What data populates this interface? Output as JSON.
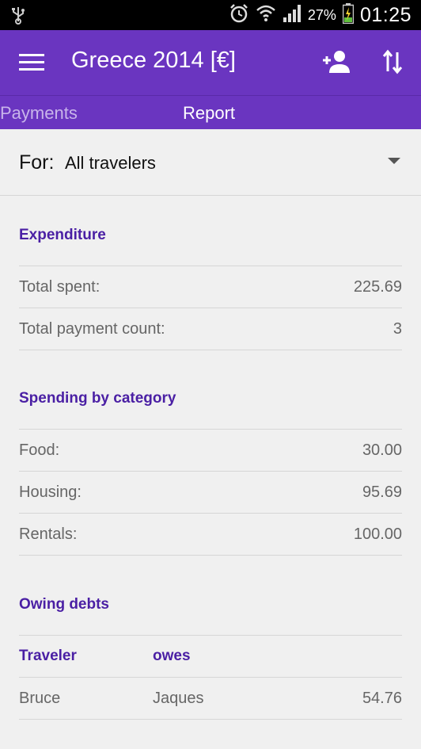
{
  "status_bar": {
    "battery_percent": "27%",
    "time": "01:25",
    "icons": [
      "usb-icon",
      "alarm-icon",
      "wifi-icon",
      "signal-icon",
      "battery-charging-icon"
    ]
  },
  "app_bar": {
    "title": "Greece 2014 [€]",
    "icons": [
      "menu-icon",
      "add-person-icon",
      "sort-icon"
    ]
  },
  "tabs": [
    {
      "label": "Payments",
      "selected": false
    },
    {
      "label": "Report",
      "selected": true
    }
  ],
  "filter": {
    "label": "For:",
    "value": "All travelers"
  },
  "expenditure": {
    "title": "Expenditure",
    "rows": [
      {
        "label": "Total spent:",
        "value": "225.69"
      },
      {
        "label": "Total payment count:",
        "value": "3"
      }
    ]
  },
  "spending": {
    "title": "Spending by category",
    "rows": [
      {
        "label": "Food:",
        "value": "30.00"
      },
      {
        "label": "Housing:",
        "value": "95.69"
      },
      {
        "label": "Rentals:",
        "value": "100.00"
      }
    ]
  },
  "debts": {
    "title": "Owing debts",
    "header": {
      "traveler": "Traveler",
      "owes": "owes"
    },
    "rows": [
      {
        "traveler": "Bruce",
        "owes": "Jaques",
        "amount": "54.76"
      }
    ]
  },
  "colors": {
    "primary": "#6a35c0",
    "accent_text": "#4a1fa4",
    "background": "#f0f0f0"
  }
}
